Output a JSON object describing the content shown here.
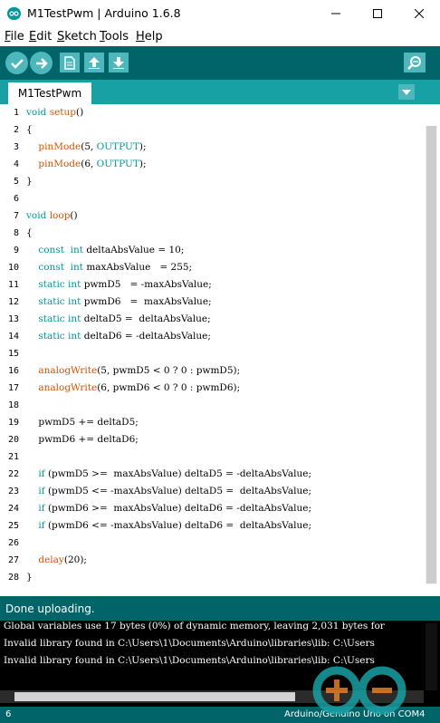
{
  "window": {
    "title": "M1TestPwm | Arduino 1.6.8",
    "controls": [
      "minimize-icon",
      "maximize-icon",
      "close-icon"
    ]
  },
  "menu": {
    "items": [
      {
        "label": "File"
      },
      {
        "label": "Edit"
      },
      {
        "label": "Sketch"
      },
      {
        "label": "Tools"
      },
      {
        "label": "Help"
      }
    ]
  },
  "toolbar": {
    "buttons": [
      "verify-icon",
      "upload-icon",
      "new-icon",
      "open-icon",
      "save-icon",
      "serial-monitor-icon"
    ]
  },
  "tabs": [
    {
      "label": "M1TestPwm",
      "active": true
    }
  ],
  "editor": {
    "line_numbers": [
      "1",
      "2",
      "3",
      "4",
      "5",
      "6",
      "7",
      "8",
      "9",
      "10",
      "11",
      "12",
      "13",
      "14",
      "15",
      "16",
      "17",
      "18",
      "19",
      "20",
      "21",
      "22",
      "23",
      "24",
      "25",
      "26",
      "27",
      "28"
    ],
    "code_lines": [
      "void setup()",
      "{",
      "    pinMode(5, OUTPUT);",
      "    pinMode(6, OUTPUT);",
      "}",
      "",
      "void loop()",
      "{",
      "    const  int deltaAbsValue = 10;",
      "    const  int maxAbsValue   = 255;",
      "    static int pwmD5   = -maxAbsValue;",
      "    static int pwmD6   =  maxAbsValue;",
      "    static int deltaD5 =  deltaAbsValue;",
      "    static int deltaD6 = -deltaAbsValue;",
      "",
      "    analogWrite(5, pwmD5 < 0 ? 0 : pwmD5);",
      "    analogWrite(6, pwmD6 < 0 ? 0 : pwmD6);",
      "",
      "    pwmD5 += deltaD5;",
      "    pwmD6 += deltaD6;",
      "",
      "    if (pwmD5 >=  maxAbsValue) deltaD5 = -deltaAbsValue;",
      "    if (pwmD5 <= -maxAbsValue) deltaD5 =  deltaAbsValue;",
      "    if (pwmD6 >=  maxAbsValue) deltaD6 = -deltaAbsValue;",
      "    if (pwmD6 <= -maxAbsValue) deltaD6 =  deltaAbsValue;",
      "",
      "    delay(20);",
      "}"
    ]
  },
  "status": {
    "message": "Done uploading."
  },
  "console": {
    "lines": [
      "Global variables use 17 bytes (0%) of dynamic memory, leaving 2,031 bytes for",
      "Invalid library found in C:\\Users\\1\\Documents\\Arduino\\libraries\\lib: C:\\Users",
      "Invalid library found in C:\\Users\\1\\Documents\\Arduino\\libraries\\lib: C:\\Users"
    ]
  },
  "footer": {
    "line": "6",
    "board": "Arduino/Genuino Uno on COM4"
  },
  "colors": {
    "toolbar": "#006468",
    "tabbar": "#17a1a5",
    "button": "#4db7bb",
    "keyword": "#00979c",
    "function": "#d35400"
  }
}
